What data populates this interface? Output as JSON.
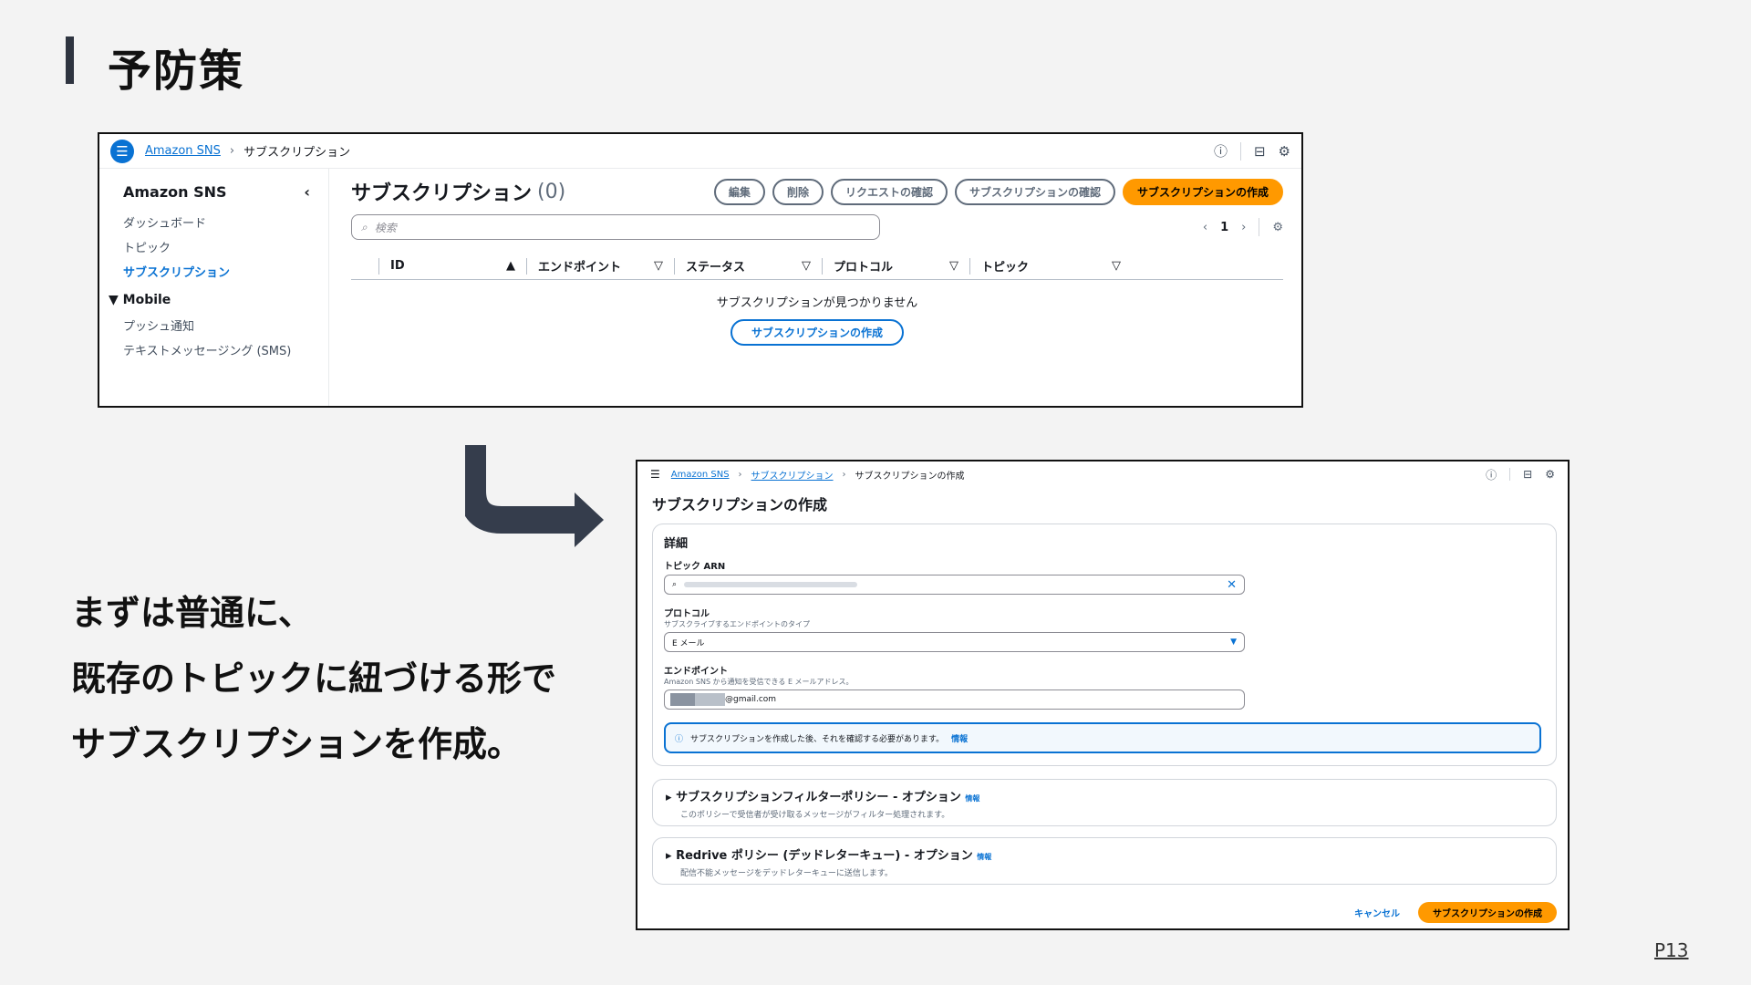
{
  "slide": {
    "title": "予防策",
    "body_lines": [
      "まずは普通に、",
      "既存のトピックに紐づける形で",
      "サブスクリプションを作成。"
    ],
    "page_number": "P13"
  },
  "shot1": {
    "breadcrumb": [
      "Amazon SNS",
      "サブスクリプション"
    ],
    "sidebar": {
      "title": "Amazon SNS",
      "items": [
        "ダッシュボード",
        "トピック",
        "サブスクリプション"
      ],
      "section": "Mobile",
      "section_items": [
        "プッシュ通知",
        "テキストメッセージング (SMS)"
      ]
    },
    "title": "サブスクリプション",
    "count": "(0)",
    "buttons": [
      "編集",
      "削除",
      "リクエストの確認",
      "サブスクリプションの確認",
      "サブスクリプションの作成"
    ],
    "search_placeholder": "検索",
    "page": "1",
    "columns": [
      "ID",
      "エンドポイント",
      "ステータス",
      "プロトコル",
      "トピック"
    ],
    "empty_message": "サブスクリプションが見つかりません",
    "empty_button": "サブスクリプションの作成"
  },
  "shot2": {
    "breadcrumb": [
      "Amazon SNS",
      "サブスクリプション",
      "サブスクリプションの作成"
    ],
    "title": "サブスクリプションの作成",
    "details": {
      "heading": "詳細",
      "topic_label": "トピック ARN",
      "protocol_label": "プロトコル",
      "protocol_desc": "サブスクライブするエンドポイントのタイプ",
      "protocol_value": "E メール",
      "endpoint_label": "エンドポイント",
      "endpoint_desc": "Amazon SNS から通知を受信できる E メールアドレス。",
      "endpoint_value": "@gmail.com",
      "info_text": "サブスクリプションを作成した後、それを確認する必要があります。",
      "info_link": "情報"
    },
    "filter": {
      "title": "サブスクリプションフィルターポリシー - オプション",
      "link": "情報",
      "desc": "このポリシーで受信者が受け取るメッセージがフィルター処理されます。"
    },
    "redrive": {
      "title": "Redrive ポリシー (デッドレターキュー) - オプション",
      "link": "情報",
      "desc": "配信不能メッセージをデッドレターキューに送信します。"
    },
    "cancel": "キャンセル",
    "create": "サブスクリプションの作成"
  }
}
